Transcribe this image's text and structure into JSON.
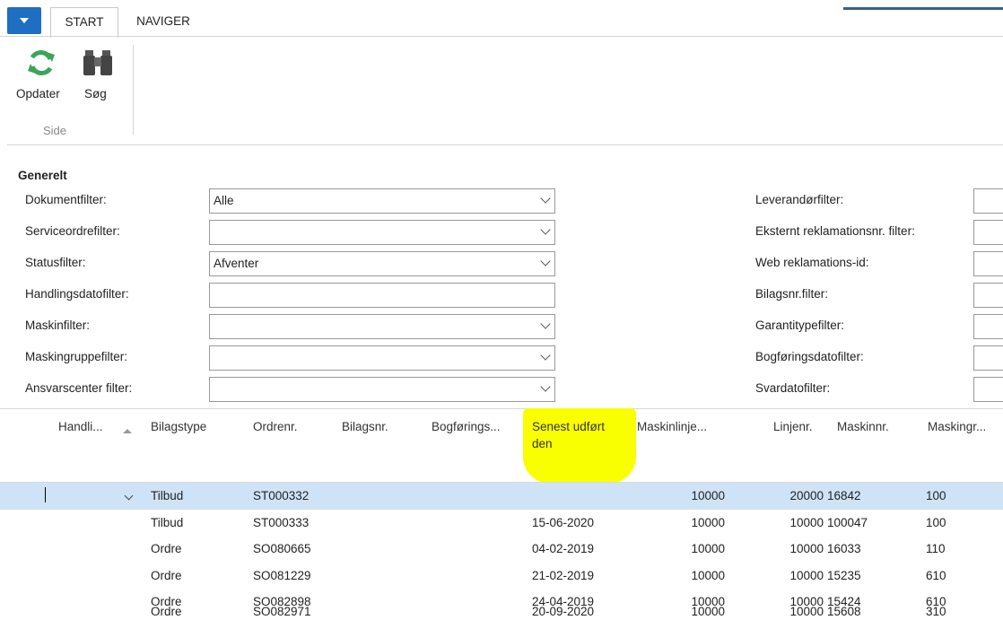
{
  "tabs": {
    "start": "START",
    "naviger": "NAVIGER"
  },
  "ribbon": {
    "refresh_label": "Opdater",
    "search_label": "Søg",
    "group_label": "Side"
  },
  "section_title": "Generelt",
  "filters_left": [
    {
      "label": "Dokumentfilter:",
      "value": "Alle",
      "dropdown": true
    },
    {
      "label": "Serviceordrefilter:",
      "value": "",
      "dropdown": true
    },
    {
      "label": "Statusfilter:",
      "value": "Afventer",
      "dropdown": true
    },
    {
      "label": "Handlingsdatofilter:",
      "value": "",
      "dropdown": false
    },
    {
      "label": "Maskinfilter:",
      "value": "",
      "dropdown": true
    },
    {
      "label": "Maskingruppefilter:",
      "value": "",
      "dropdown": true
    },
    {
      "label": "Ansvarscenter filter:",
      "value": "",
      "dropdown": true
    }
  ],
  "filters_right": [
    {
      "label": "Leverandørfilter:"
    },
    {
      "label": "Eksternt reklamationsnr. filter:"
    },
    {
      "label": "Web reklamations-id:"
    },
    {
      "label": "Bilagsnr.filter:"
    },
    {
      "label": "Garantitypefilter:"
    },
    {
      "label": "Bogføringsdatofilter:"
    },
    {
      "label": "Svardatofilter:"
    }
  ],
  "columns": {
    "handling": "Handli...",
    "bilagstype": "Bilagstype",
    "ordrenr": "Ordrenr.",
    "bilagsnr": "Bilagsnr.",
    "bogforing": "Bogførings...",
    "senest_line1": "Senest udført",
    "senest_line2": "den",
    "maskinlinje": "Maskinlinje...",
    "linjenr": "Linjenr.",
    "maskinnr": "Maskinnr.",
    "maskingr": "Maskingr..."
  },
  "rows": [
    {
      "bilagstype": "Tilbud",
      "ordrenr": "ST000332",
      "senest": "",
      "maskinlinje": "10000",
      "linjenr": "20000",
      "maskinnr": "16842",
      "maskingr": "100"
    },
    {
      "bilagstype": "Tilbud",
      "ordrenr": "ST000333",
      "senest": "15-06-2020",
      "maskinlinje": "10000",
      "linjenr": "10000",
      "maskinnr": "100047",
      "maskingr": "100"
    },
    {
      "bilagstype": "Ordre",
      "ordrenr": "SO080665",
      "senest": "04-02-2019",
      "maskinlinje": "10000",
      "linjenr": "10000",
      "maskinnr": "16033",
      "maskingr": "110"
    },
    {
      "bilagstype": "Ordre",
      "ordrenr": "SO081229",
      "senest": "21-02-2019",
      "maskinlinje": "10000",
      "linjenr": "10000",
      "maskinnr": "15235",
      "maskingr": "610"
    },
    {
      "bilagstype": "Ordre",
      "ordrenr": "SO082898",
      "senest": "24-04-2019",
      "maskinlinje": "10000",
      "linjenr": "10000",
      "maskinnr": "15424",
      "maskingr": "610"
    },
    {
      "bilagstype": "Ordre",
      "ordrenr": "SO082971",
      "senest": "20-09-2020",
      "maskinlinje": "10000",
      "linjenr": "10000",
      "maskinnr": "15608",
      "maskingr": "310"
    }
  ],
  "colors": {
    "accent": "#1e6fc2",
    "selected_row": "#cfe3f6",
    "highlight": "#faff00"
  }
}
